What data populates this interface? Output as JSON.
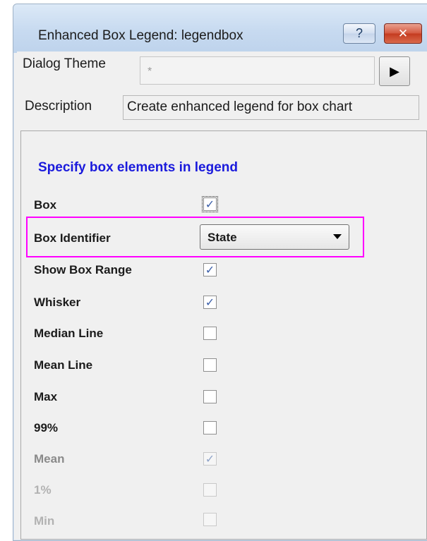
{
  "window": {
    "title": "Enhanced Box Legend: legendbox",
    "help_label": "?",
    "close_label": "✕"
  },
  "dialog_theme": {
    "label": "Dialog Theme",
    "value": "*",
    "menu_arrow": "▶"
  },
  "description": {
    "label": "Description",
    "value": "Create enhanced legend for box chart"
  },
  "section": {
    "title": "Specify box elements in legend"
  },
  "box_identifier": {
    "label": "Box Identifier",
    "selected": "State"
  },
  "highlight_color": "#ff00ff",
  "check_glyph": "✓",
  "rows": [
    {
      "label": "Box",
      "checked": true,
      "enabled": true
    },
    {
      "label": "Show Box Range",
      "checked": true,
      "enabled": true
    },
    {
      "label": "Whisker",
      "checked": true,
      "enabled": true
    },
    {
      "label": "Median Line",
      "checked": false,
      "enabled": true
    },
    {
      "label": "Mean Line",
      "checked": false,
      "enabled": true
    },
    {
      "label": "Max",
      "checked": false,
      "enabled": true
    },
    {
      "label": "99%",
      "checked": false,
      "enabled": true
    },
    {
      "label": "Mean",
      "checked": true,
      "enabled": false
    },
    {
      "label": "1%",
      "checked": false,
      "enabled": false
    },
    {
      "label": "Min",
      "checked": false,
      "enabled": false
    }
  ]
}
